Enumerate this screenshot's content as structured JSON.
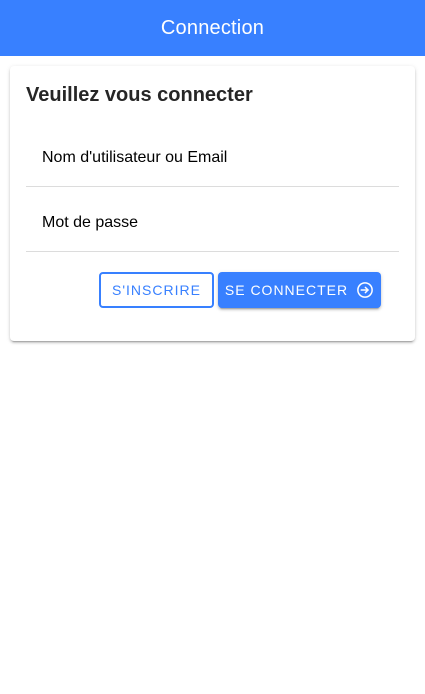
{
  "header": {
    "title": "Connection"
  },
  "login_card": {
    "title": "Veuillez vous connecter",
    "username_field": {
      "placeholder": "Nom d'utilisateur ou Email",
      "value": ""
    },
    "password_field": {
      "placeholder": "Mot de passe",
      "value": ""
    },
    "register_label": "S'inscrire",
    "login_label": "Se connecter",
    "login_icon": "log-in-icon"
  },
  "colors": {
    "primary": "#3880ff",
    "card_title": "#262626",
    "divider": "#dcdcdc"
  }
}
